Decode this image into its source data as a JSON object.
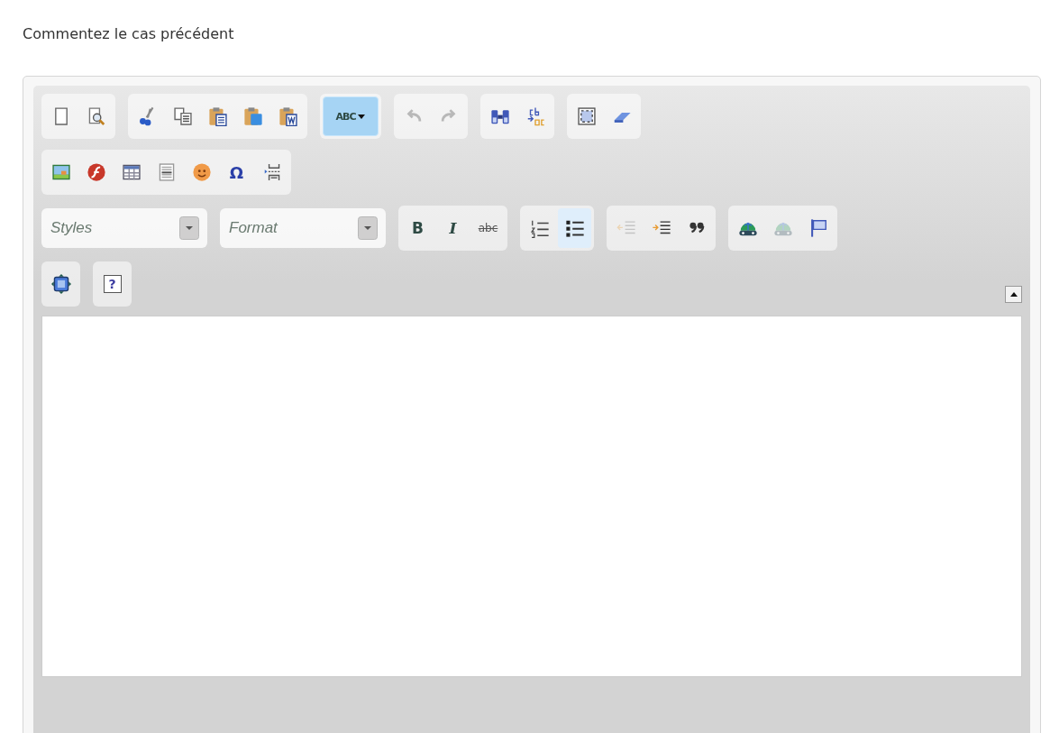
{
  "label": "Commentez le cas précédent",
  "toolbar_rows": [
    {
      "groups": [
        {
          "items": [
            {
              "kind": "new-page",
              "disabled": false,
              "on": false
            },
            {
              "kind": "preview",
              "disabled": false,
              "on": false
            }
          ]
        },
        {
          "items": [
            {
              "kind": "cut",
              "disabled": false,
              "on": false
            },
            {
              "kind": "copy",
              "disabled": false,
              "on": false
            },
            {
              "kind": "paste",
              "disabled": false,
              "on": false
            },
            {
              "kind": "paste-text",
              "disabled": false,
              "on": false
            },
            {
              "kind": "paste-word",
              "disabled": false,
              "on": false
            }
          ]
        },
        {
          "items": [
            {
              "kind": "spellcheck",
              "label": "ABC",
              "disabled": false,
              "on": true
            }
          ]
        },
        {
          "items": [
            {
              "kind": "undo",
              "disabled": true,
              "on": false
            },
            {
              "kind": "redo",
              "disabled": true,
              "on": false
            }
          ]
        },
        {
          "items": [
            {
              "kind": "find",
              "disabled": false,
              "on": false
            },
            {
              "kind": "replace",
              "disabled": false,
              "on": false
            }
          ]
        },
        {
          "items": [
            {
              "kind": "select-all",
              "disabled": false,
              "on": false
            },
            {
              "kind": "remove-format",
              "disabled": false,
              "on": false
            }
          ]
        }
      ]
    },
    {
      "groups": [
        {
          "items": [
            {
              "kind": "image",
              "disabled": false,
              "on": false
            },
            {
              "kind": "flash",
              "disabled": false,
              "on": false
            },
            {
              "kind": "table",
              "disabled": false,
              "on": false
            },
            {
              "kind": "horizontal-rule",
              "disabled": false,
              "on": false
            },
            {
              "kind": "smiley",
              "disabled": false,
              "on": false
            },
            {
              "kind": "special-char",
              "label": "Ω",
              "disabled": false,
              "on": false
            },
            {
              "kind": "page-break",
              "disabled": false,
              "on": false
            }
          ]
        }
      ]
    },
    {
      "combos": [
        {
          "placeholder": "Styles"
        },
        {
          "placeholder": "Format"
        }
      ],
      "groups": [
        {
          "items": [
            {
              "kind": "bold",
              "label": "B",
              "disabled": false,
              "on": false
            },
            {
              "kind": "italic",
              "label": "I",
              "disabled": false,
              "on": false
            },
            {
              "kind": "strike",
              "label": "abc",
              "disabled": false,
              "on": false
            }
          ]
        },
        {
          "items": [
            {
              "kind": "ordered-list",
              "disabled": false,
              "on": false
            },
            {
              "kind": "bullet-list",
              "disabled": false,
              "on": true
            }
          ]
        },
        {
          "items": [
            {
              "kind": "outdent",
              "disabled": true,
              "on": false
            },
            {
              "kind": "indent",
              "disabled": false,
              "on": false
            },
            {
              "kind": "blockquote",
              "disabled": false,
              "on": false
            }
          ]
        },
        {
          "items": [
            {
              "kind": "link",
              "disabled": false,
              "on": false
            },
            {
              "kind": "unlink",
              "disabled": true,
              "on": false
            },
            {
              "kind": "anchor",
              "disabled": false,
              "on": false
            }
          ]
        }
      ]
    },
    {
      "groups": [
        {
          "items": [
            {
              "kind": "maximize",
              "disabled": false,
              "on": false
            }
          ]
        },
        {
          "items": [
            {
              "kind": "about",
              "label": "?",
              "disabled": false,
              "on": false
            }
          ]
        }
      ]
    }
  ]
}
